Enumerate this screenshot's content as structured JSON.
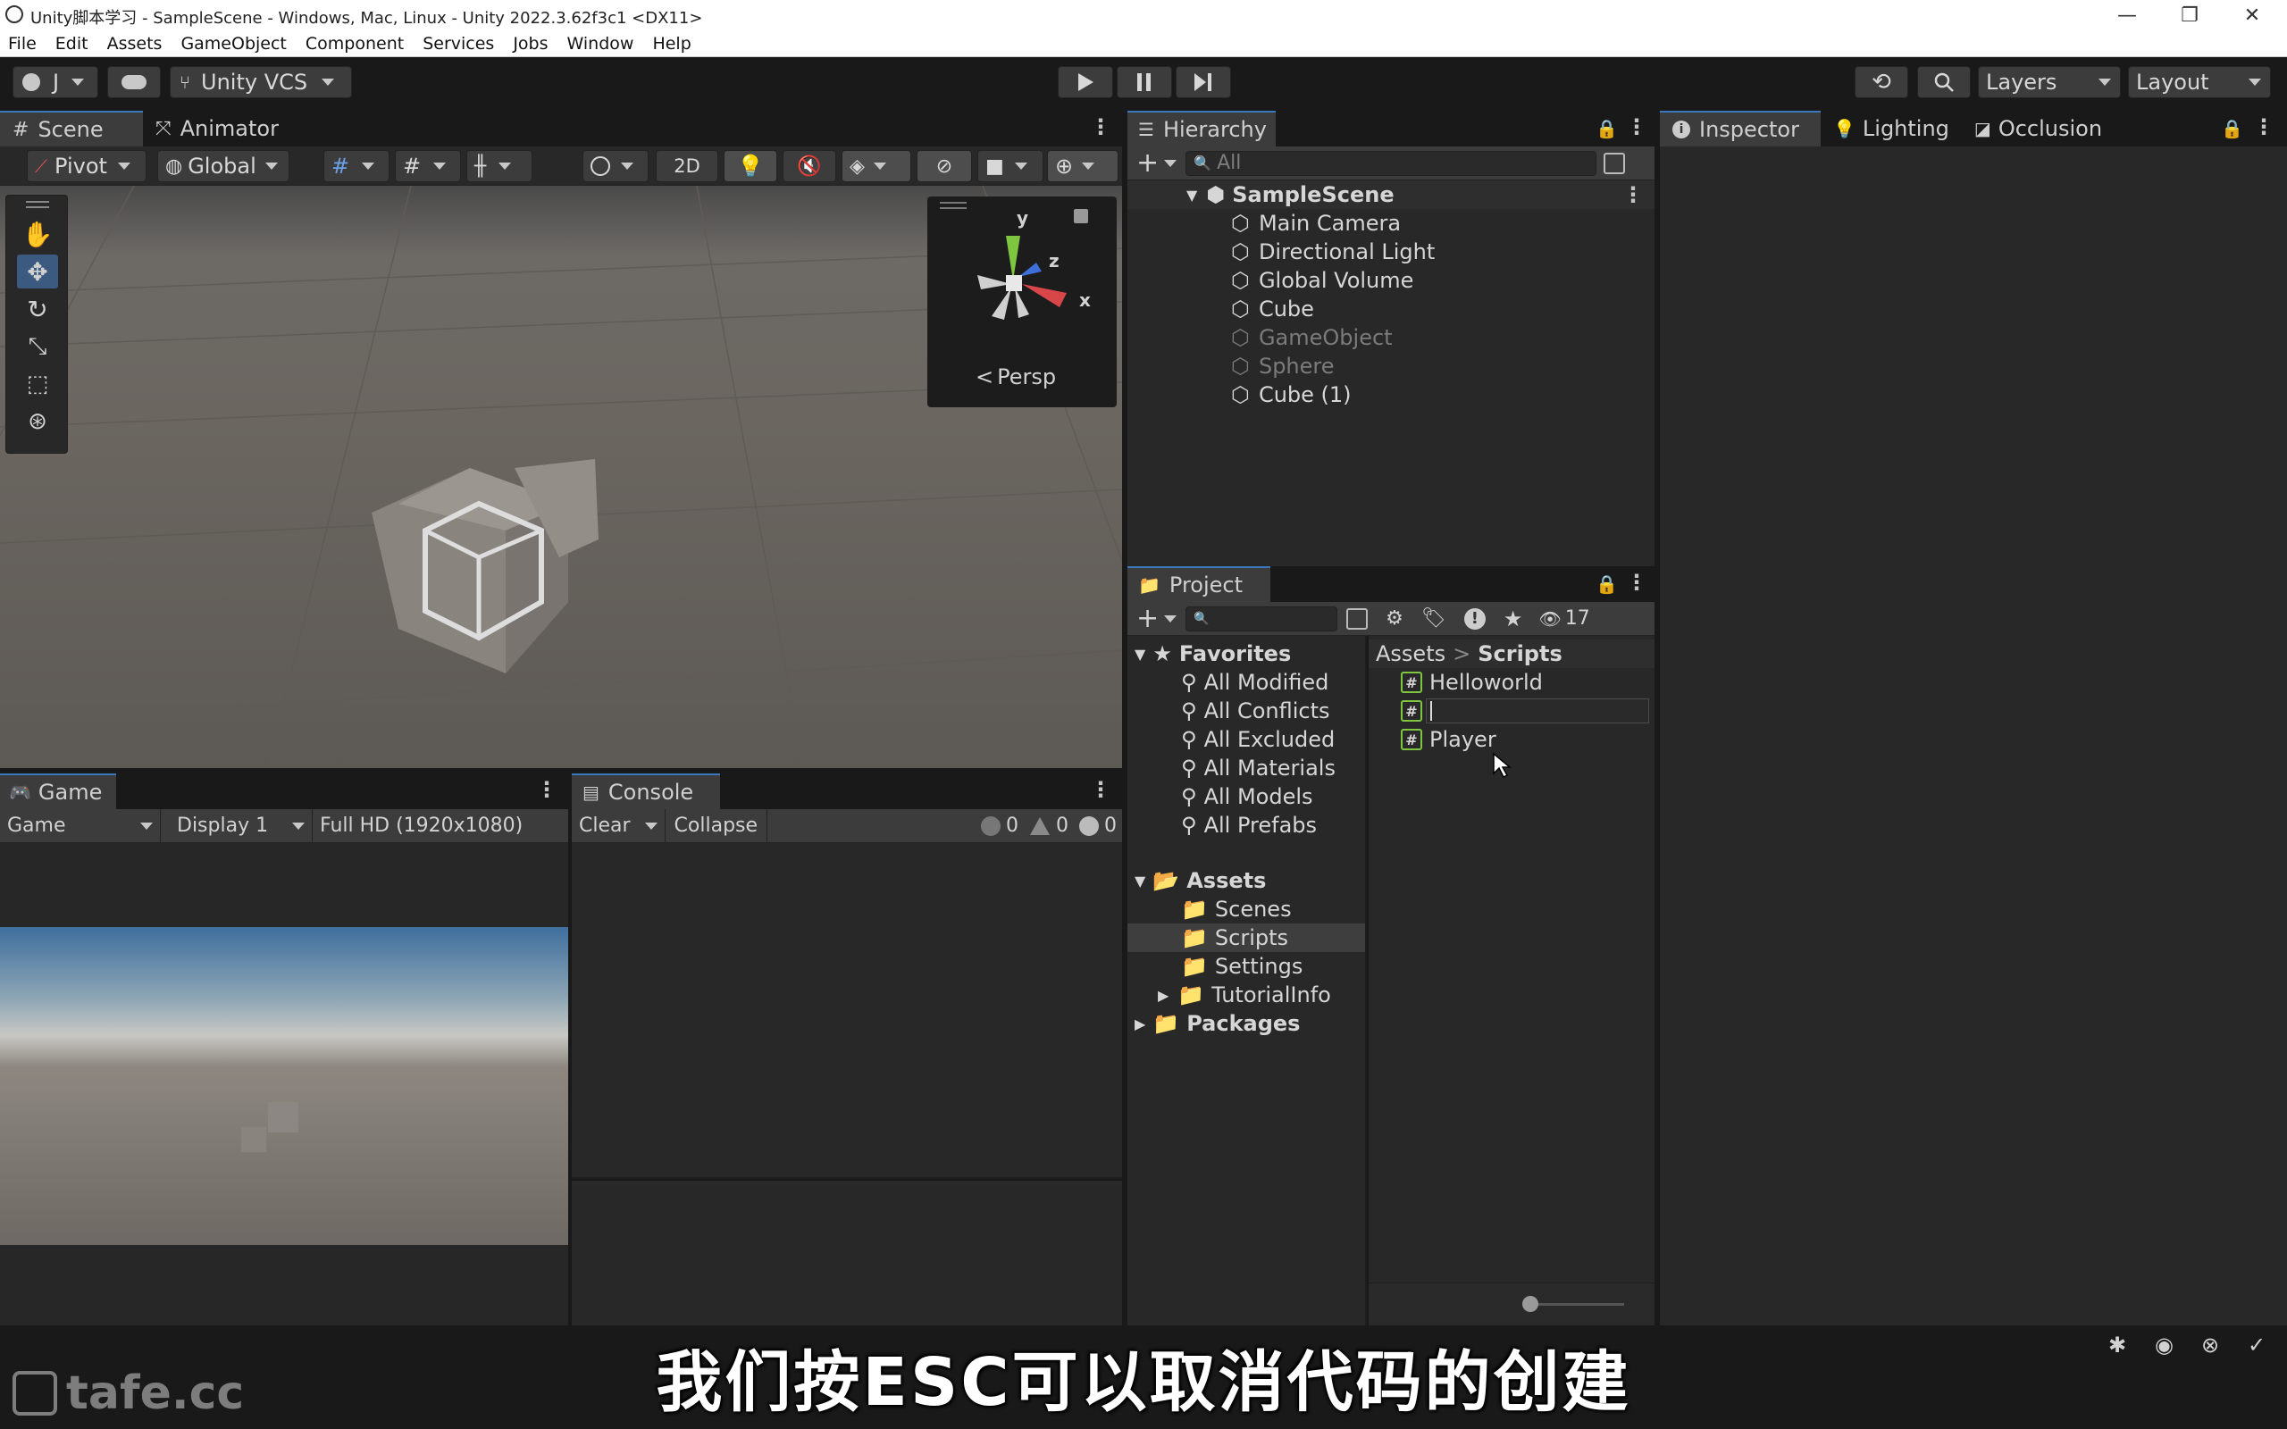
{
  "window": {
    "title": "Unity脚本学习 - SampleScene - Windows, Mac, Linux - Unity 2022.3.62f3c1 <DX11>",
    "minimize": "—",
    "maximize": "❐",
    "close": "✕"
  },
  "menu": [
    "File",
    "Edit",
    "Assets",
    "GameObject",
    "Component",
    "Services",
    "Jobs",
    "Window",
    "Help"
  ],
  "toolbar": {
    "account": "J",
    "vcs": "Unity VCS",
    "layers": "Layers",
    "layout": "Layout"
  },
  "scene": {
    "tabs": [
      "Scene",
      "Animator"
    ],
    "pivot": "Pivot",
    "global": "Global",
    "mode2d": "2D",
    "persp": "Persp",
    "axis_y": "y",
    "axis_z": "z",
    "axis_x": "x"
  },
  "hierarchy": {
    "title": "Hierarchy",
    "search_placeholder": "All",
    "scene": "SampleScene",
    "items": [
      {
        "label": "Main Camera",
        "active": true
      },
      {
        "label": "Directional Light",
        "active": true
      },
      {
        "label": "Global Volume",
        "active": true
      },
      {
        "label": "Cube",
        "active": true
      },
      {
        "label": "GameObject",
        "active": false
      },
      {
        "label": "Sphere",
        "active": false
      },
      {
        "label": "Cube (1)",
        "active": true
      }
    ]
  },
  "inspector": {
    "tabs": [
      "Inspector",
      "Lighting",
      "Occlusion"
    ]
  },
  "project": {
    "title": "Project",
    "hidden_count": "17",
    "favorites": {
      "label": "Favorites",
      "items": [
        "All Modified",
        "All Conflicts",
        "All Excluded",
        "All Materials",
        "All Models",
        "All Prefabs"
      ]
    },
    "assets": {
      "label": "Assets",
      "items": [
        "Scenes",
        "Scripts",
        "Settings",
        "TutorialInfo"
      ]
    },
    "packages": "Packages",
    "breadcrumb": {
      "root": "Assets",
      "sep": ">",
      "current": "Scripts"
    },
    "files": [
      "Helloworld",
      "",
      "Player"
    ],
    "hash": "#"
  },
  "game": {
    "tab": "Game",
    "mode": "Game",
    "display": "Display 1",
    "resolution": "Full HD (1920x1080)"
  },
  "console": {
    "tab": "Console",
    "clear": "Clear",
    "collapse": "Collapse",
    "info_count": "0",
    "warn_count": "0",
    "error_count": "0"
  },
  "subtitle": "我们按ESC可以取消代码的创建",
  "watermark": "tafe.cc",
  "colors": {
    "accent": "#3a79bb",
    "panel": "#282828",
    "bar": "#3c3c3c"
  }
}
